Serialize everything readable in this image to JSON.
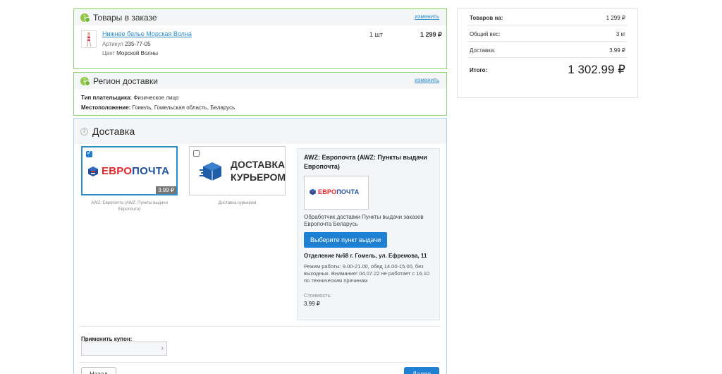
{
  "order_items": {
    "title": "Товары в заказе",
    "change_label": "изменить",
    "item": {
      "name": "Нижнее белье Морская Волна",
      "article_key": "Артикул",
      "article_value": "235-77-05",
      "color_key": "Цвет",
      "color_value": "Морской Волны",
      "quantity": "1 шт",
      "price": "1 299 ₽"
    }
  },
  "region": {
    "title": "Регион доставки",
    "change_label": "изменить",
    "payer_label": "Тип плательщика:",
    "payer_value": "Физическое лицо",
    "location_label": "Местоположение:",
    "location_value": "Гомель, Гомельская область, Беларусь"
  },
  "delivery": {
    "step": "3",
    "title": "Доставка",
    "options": [
      {
        "logo_text_red": "ЕВРО",
        "logo_text_blue": "ПОЧТА",
        "price": "3.99 ₽",
        "caption": "AWZ: Европочта (AWZ: Пункты выдачи Европочта)",
        "selected": true
      },
      {
        "logo_text_line1": "ДОСТАВКА",
        "logo_text_line2": "КУРЬЕРОМ",
        "caption": "Доставка курьером",
        "selected": false
      }
    ],
    "info": {
      "title": "AWZ: Европочта (AWZ: Пункты выдачи Европочта)",
      "logo_red": "ЕВРО",
      "logo_blue": "ПОЧТА",
      "description": "Обработчик доставки Пункты выдачи заказов Европочта Беларусь",
      "pick_button": "Выберите пункт выдачи",
      "office": "Отделение №68 г. Гомель, ул. Ефремова, 11",
      "hours": "Режим работы: 9.00-21.00, обед 14.00-15.00, без выходных. Внимание! 04.07.22 не работает с 16.10 по техническим причинам",
      "cost_label": "Стоимость:",
      "cost_value": "3.99 ₽"
    },
    "coupon_label": "Применить купон:",
    "coupon_placeholder": "",
    "back_button": "Назад",
    "next_button": "Далее"
  },
  "summary": {
    "rows": [
      {
        "label": "Товаров на:",
        "value": "1 299 ₽"
      },
      {
        "label": "Общий вес:",
        "value": "3 кг"
      },
      {
        "label": "Доставка:",
        "value": "3.99 ₽"
      }
    ],
    "total_label": "Итого:",
    "total_value": "1 302.99 ₽"
  },
  "colors": {
    "accent": "#1f7fd1",
    "success_border": "#8ed16f",
    "brand_red": "#e3262c",
    "brand_blue": "#1e4f9c"
  },
  "icons": [
    "check-circle-icon",
    "chevron-right-icon",
    "box-icon",
    "evropochta-logo-icon"
  ]
}
